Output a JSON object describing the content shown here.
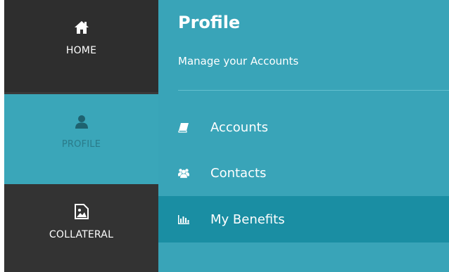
{
  "sidebar": {
    "items": [
      {
        "label": "HOME",
        "icon": "home-icon",
        "state": "inactive"
      },
      {
        "label": "PROFILE",
        "icon": "user-icon",
        "state": "active"
      },
      {
        "label": "COLLATERAL",
        "icon": "image-file-icon",
        "state": "inactive"
      }
    ]
  },
  "main": {
    "title": "Profile",
    "subtitle": "Manage your Accounts",
    "menu": [
      {
        "label": "Accounts",
        "icon": "book-icon"
      },
      {
        "label": "Contacts",
        "icon": "users-icon"
      },
      {
        "label": "My Benefits",
        "icon": "bar-chart-icon",
        "selected": true
      }
    ]
  },
  "colors": {
    "rail_dark": "#2e2e2e",
    "accent_teal": "#39a4b8",
    "selected_teal": "#1a8ea3",
    "text_white": "#ffffff"
  }
}
